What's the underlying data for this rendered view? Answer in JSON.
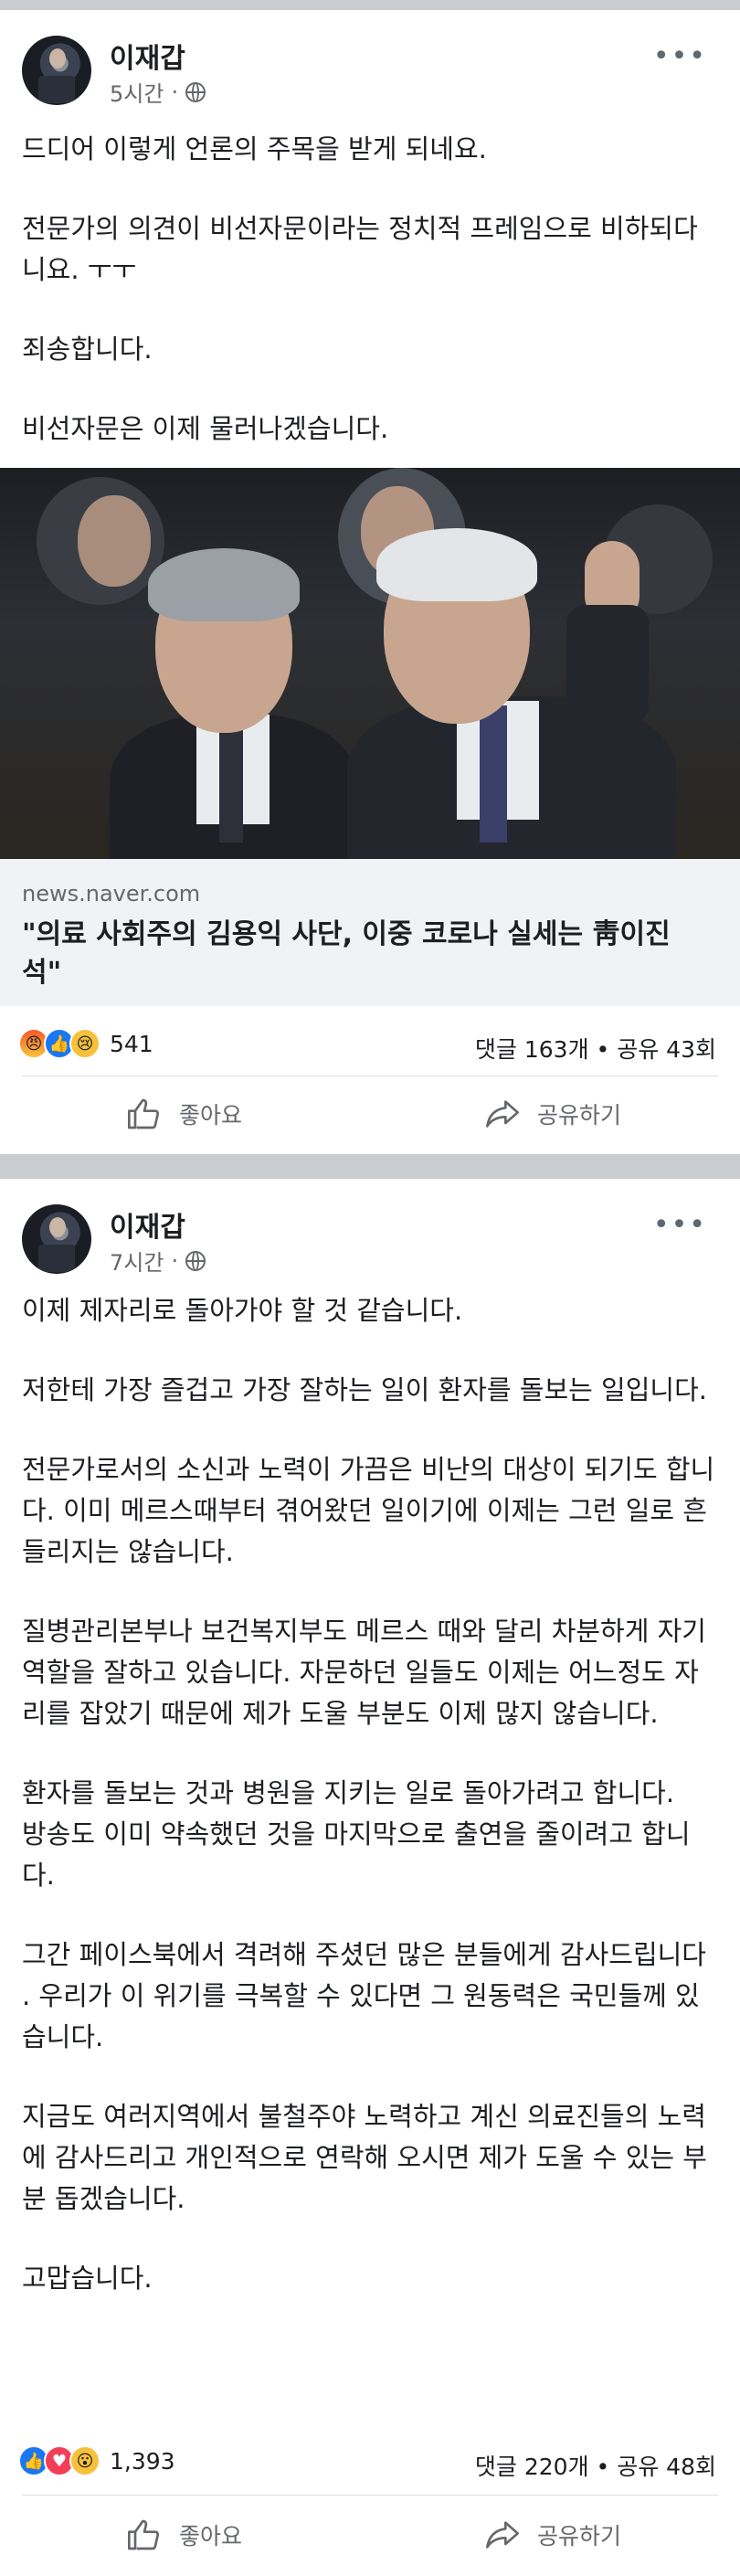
{
  "posts": [
    {
      "author": "이재갑",
      "time": "5시간",
      "dot": "·",
      "more": "•••",
      "paragraphs": [
        "드디어 이렇게 언론의 주목을 받게 되네요.",
        "전문가의 의견이 비선자문이라는 정치적 프레임으로 비하되다니요. ㅜㅜ",
        "죄송합니다.",
        "비선자문은 이제 물러나겠습니다."
      ],
      "link": {
        "domain": "news.naver.com",
        "title": "\"의료 사회주의 김용익 사단, 이중 코로나 실세는 靑이진석\""
      },
      "reaction_count": "541",
      "counts": "댓글 163개 • 공유 43회",
      "like_label": "좋아요",
      "share_label": "공유하기",
      "colors": {
        "angry": "#f55a29",
        "like": "#1877f2",
        "sad": "#f7c13b"
      }
    },
    {
      "author": "이재갑",
      "time": "7시간",
      "dot": "·",
      "more": "•••",
      "paragraphs": [
        "이제 제자리로 돌아가야 할 것 같습니다.",
        "",
        "저한테 가장 즐겁고 가장 잘하는 일이 환자를 돌보는 일입니다.",
        "",
        "전문가로서의 소신과 노력이 가끔은 비난의 대상이 되기도 합니다. 이미 메르스때부터 겪어왔던 일이기에 이제는 그런 일로 흔들리지는 않습니다.",
        "",
        "질병관리본부나 보건복지부도 메르스 때와 달리 차분하게 자기 역할을 잘하고 있습니다. 자문하던 일들도 이제는 어느정도 자리를 잡았기 때문에 제가 도울 부분도 이제 많지 않습니다.",
        "",
        "환자를 돌보는 것과 병원을 지키는 일로 돌아가려고 합니다.",
        "방송도 이미 약속했던 것을 마지막으로 출연을 줄이려고 합니다.",
        "",
        "그간 페이스북에서 격려해 주셨던 많은 분들에게 감사드립니다 .  우리가 이 위기를 극복할 수 있다면 그 원동력은 국민들께 있습니다.",
        "",
        "지금도 여러지역에서 불철주야 노력하고 계신 의료진들의 노력에 감사드리고 개인적으로 연락해 오시면 제가 도울 수 있는 부분 돕겠습니다.",
        "",
        "고맙습니다."
      ],
      "reaction_count": "1,393",
      "counts": "댓글 220개 • 공유 48회",
      "like_label": "좋아요",
      "share_label": "공유하기",
      "colors": {
        "like": "#1877f2",
        "love": "#f33e58",
        "wow": "#f7c13b"
      }
    }
  ]
}
